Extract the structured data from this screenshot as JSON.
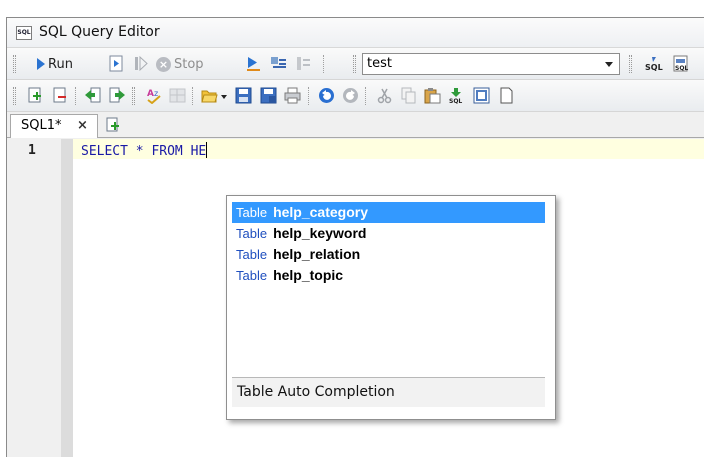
{
  "window": {
    "title": "SQL Query Editor",
    "icon": "sql-app-icon"
  },
  "toolbar1": {
    "run_label": "Run",
    "stop_label": "Stop",
    "database": "test"
  },
  "tabs": [
    {
      "label": "SQL1*",
      "close": "×"
    }
  ],
  "editor": {
    "line_number": "1",
    "code": "SELECT * FROM HE"
  },
  "autocomplete": {
    "items": [
      {
        "type": "Table",
        "name": "help_category",
        "selected": true
      },
      {
        "type": "Table",
        "name": "help_keyword"
      },
      {
        "type": "Table",
        "name": "help_relation"
      },
      {
        "type": "Table",
        "name": "help_topic"
      }
    ],
    "footer": "Table Auto Completion"
  },
  "colors": {
    "accent": "#3399ff",
    "keyword": "#1a1aa6",
    "current_line": "#ffffe0"
  }
}
